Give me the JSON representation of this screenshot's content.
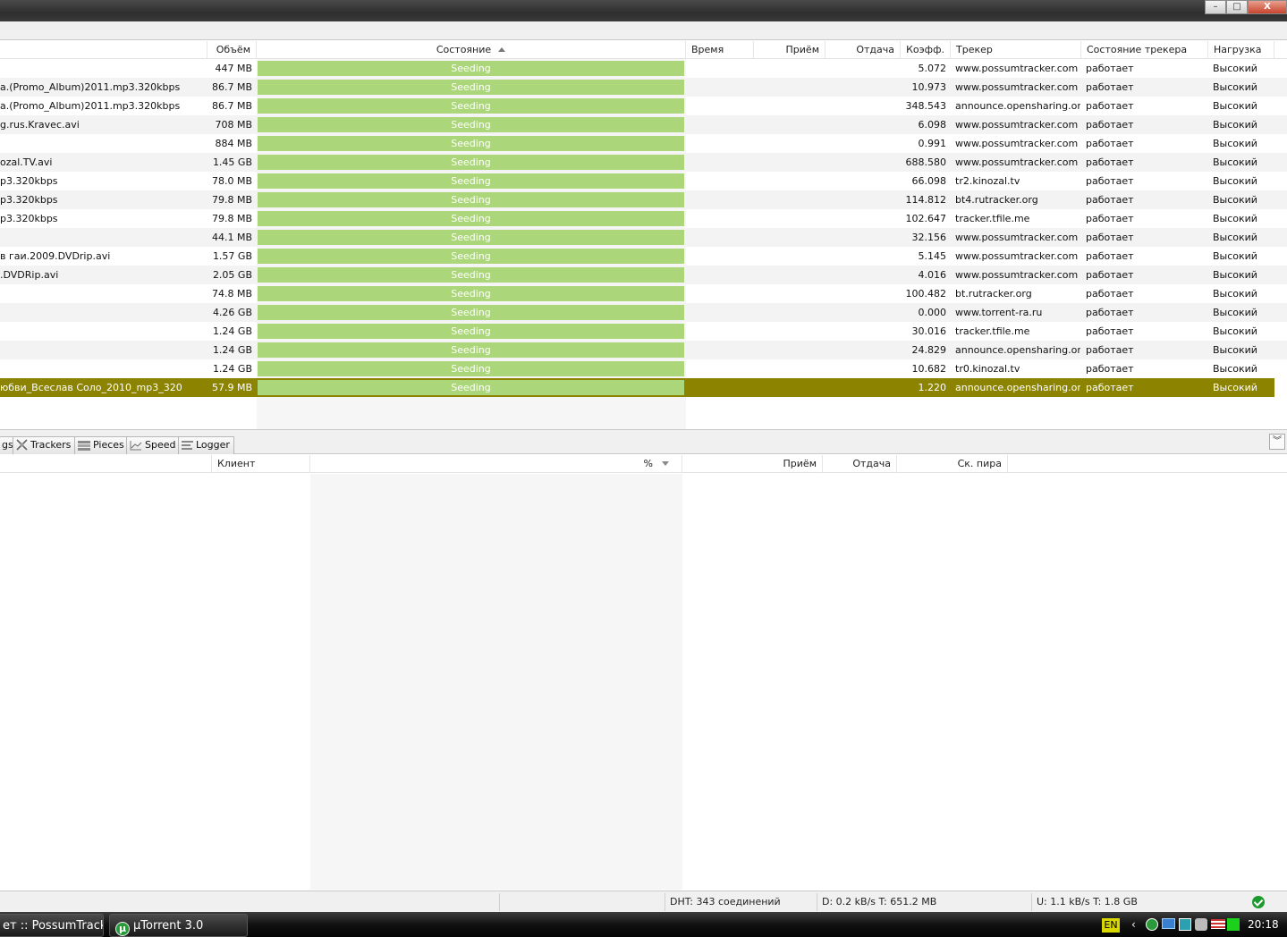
{
  "window": {
    "minimize": "–",
    "maximize": "□",
    "close": "X"
  },
  "headers": {
    "size": "Объём",
    "status": "Состояние",
    "time": "Время",
    "down": "Приём",
    "up": "Отдача",
    "ratio": "Коэфф.",
    "tracker": "Трекер",
    "tracker_state": "Состояние трекера",
    "load": "Нагрузка"
  },
  "torrents": [
    {
      "name": "",
      "size": "447 MB",
      "status": "Seeding",
      "ratio": "5.072",
      "tracker": "www.possumtracker.com",
      "tstate": "работает",
      "load": "Высокий"
    },
    {
      "name": "a.(Promo_Album)2011.mp3.320kbps",
      "size": "86.7 MB",
      "status": "Seeding",
      "ratio": "10.973",
      "tracker": "www.possumtracker.com",
      "tstate": "работает",
      "load": "Высокий"
    },
    {
      "name": "a.(Promo_Album)2011.mp3.320kbps",
      "size": "86.7 MB",
      "status": "Seeding",
      "ratio": "348.543",
      "tracker": "announce.opensharing.org",
      "tstate": "работает",
      "load": "Высокий"
    },
    {
      "name": "g.rus.Kravec.avi",
      "size": "708 MB",
      "status": "Seeding",
      "ratio": "6.098",
      "tracker": "www.possumtracker.com",
      "tstate": "работает",
      "load": "Высокий"
    },
    {
      "name": "",
      "size": "884 MB",
      "status": "Seeding",
      "ratio": "0.991",
      "tracker": "www.possumtracker.com",
      "tstate": "работает",
      "load": "Высокий"
    },
    {
      "name": "ozal.TV.avi",
      "size": "1.45 GB",
      "status": "Seeding",
      "ratio": "688.580",
      "tracker": "www.possumtracker.com",
      "tstate": "работает",
      "load": "Высокий"
    },
    {
      "name": "p3.320kbps",
      "size": "78.0 MB",
      "status": "Seeding",
      "ratio": "66.098",
      "tracker": "tr2.kinozal.tv",
      "tstate": "работает",
      "load": "Высокий"
    },
    {
      "name": "p3.320kbps",
      "size": "79.8 MB",
      "status": "Seeding",
      "ratio": "114.812",
      "tracker": "bt4.rutracker.org",
      "tstate": "работает",
      "load": "Высокий"
    },
    {
      "name": "p3.320kbps",
      "size": "79.8 MB",
      "status": "Seeding",
      "ratio": "102.647",
      "tracker": "tracker.tfile.me",
      "tstate": "работает",
      "load": "Высокий"
    },
    {
      "name": "",
      "size": "44.1 MB",
      "status": "Seeding",
      "ratio": "32.156",
      "tracker": "www.possumtracker.com",
      "tstate": "работает",
      "load": "Высокий"
    },
    {
      "name": "в гаи.2009.DVDrip.avi",
      "size": "1.57 GB",
      "status": "Seeding",
      "ratio": "5.145",
      "tracker": "www.possumtracker.com",
      "tstate": "работает",
      "load": "Высокий"
    },
    {
      "name": ".DVDRip.avi",
      "size": "2.05 GB",
      "status": "Seeding",
      "ratio": "4.016",
      "tracker": "www.possumtracker.com",
      "tstate": "работает",
      "load": "Высокий"
    },
    {
      "name": "",
      "size": "74.8 MB",
      "status": "Seeding",
      "ratio": "100.482",
      "tracker": "bt.rutracker.org",
      "tstate": "работает",
      "load": "Высокий"
    },
    {
      "name": "",
      "size": "4.26 GB",
      "status": "Seeding",
      "ratio": "0.000",
      "tracker": "www.torrent-ra.ru",
      "tstate": "работает",
      "load": "Высокий"
    },
    {
      "name": "",
      "size": "1.24 GB",
      "status": "Seeding",
      "ratio": "30.016",
      "tracker": "tracker.tfile.me",
      "tstate": "работает",
      "load": "Высокий"
    },
    {
      "name": "",
      "size": "1.24 GB",
      "status": "Seeding",
      "ratio": "24.829",
      "tracker": "announce.opensharing.org",
      "tstate": "работает",
      "load": "Высокий"
    },
    {
      "name": "",
      "size": "1.24 GB",
      "status": "Seeding",
      "ratio": "10.682",
      "tracker": "tr0.kinozal.tv",
      "tstate": "работает",
      "load": "Высокий"
    },
    {
      "name": "юбви_Всеслав Соло_2010_mp3_320",
      "size": "57.9 MB",
      "status": "Seeding",
      "ratio": "1.220",
      "tracker": "announce.opensharing.org",
      "tstate": "работает",
      "load": "Высокий",
      "selected": true
    }
  ],
  "tabs": {
    "partial": "gs",
    "trackers": "Trackers",
    "pieces": "Pieces",
    "speed": "Speed",
    "logger": "Logger"
  },
  "peers_headers": {
    "client": "Клиент",
    "percent": "%",
    "down": "Приём",
    "up": "Отдача",
    "peer_speed": "Ск. пира"
  },
  "statusbar": {
    "dht": "DHT: 343 соединений",
    "download": "D: 0.2 kB/s T: 651.2 MB",
    "upload": "U: 1.1 kB/s T: 1.8 GB"
  },
  "taskbar": {
    "task1": "ет :: PossumTrack...",
    "task2": "µTorrent 3.0",
    "lang": "EN",
    "clock": "20:18"
  },
  "colors": {
    "seeding_bar": "#acd67a",
    "selected_row": "#8c8300"
  }
}
